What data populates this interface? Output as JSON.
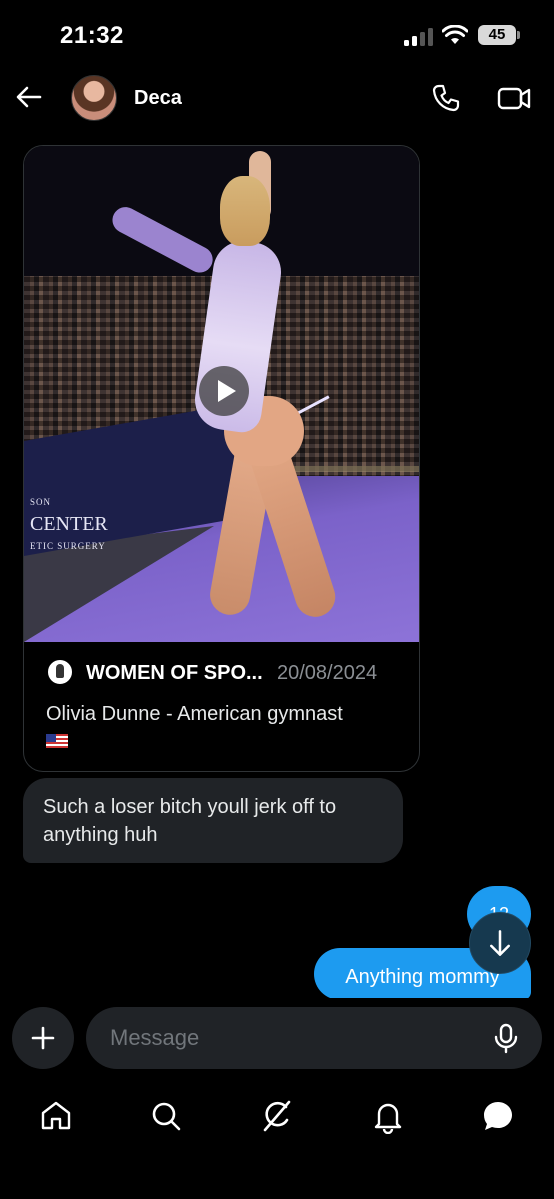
{
  "status_bar": {
    "time": "21:32",
    "battery": "45"
  },
  "header": {
    "contact_name": "Deca"
  },
  "shared_post": {
    "source_name": "WOMEN OF SPO...",
    "date": "20/08/2024",
    "description": "Olivia Dunne - American gymnast",
    "banner_text_small": "SON",
    "banner_text": "CENTER",
    "banner_text_sub": "ETIC SURGERY"
  },
  "messages": {
    "received": "Such a loser bitch youll jerk off to anything huh",
    "sent_small": "12",
    "sent": "Anything mommy"
  },
  "composer": {
    "placeholder": "Message"
  },
  "colors": {
    "accent": "#1d9bf0",
    "bubble_in": "#202327",
    "background": "#000000"
  },
  "icons": [
    "back-arrow-icon",
    "phone-icon",
    "video-icon",
    "play-icon",
    "arrow-down-icon",
    "plus-icon",
    "mic-icon",
    "home-icon",
    "search-icon",
    "grok-icon",
    "bell-icon",
    "messages-icon"
  ]
}
